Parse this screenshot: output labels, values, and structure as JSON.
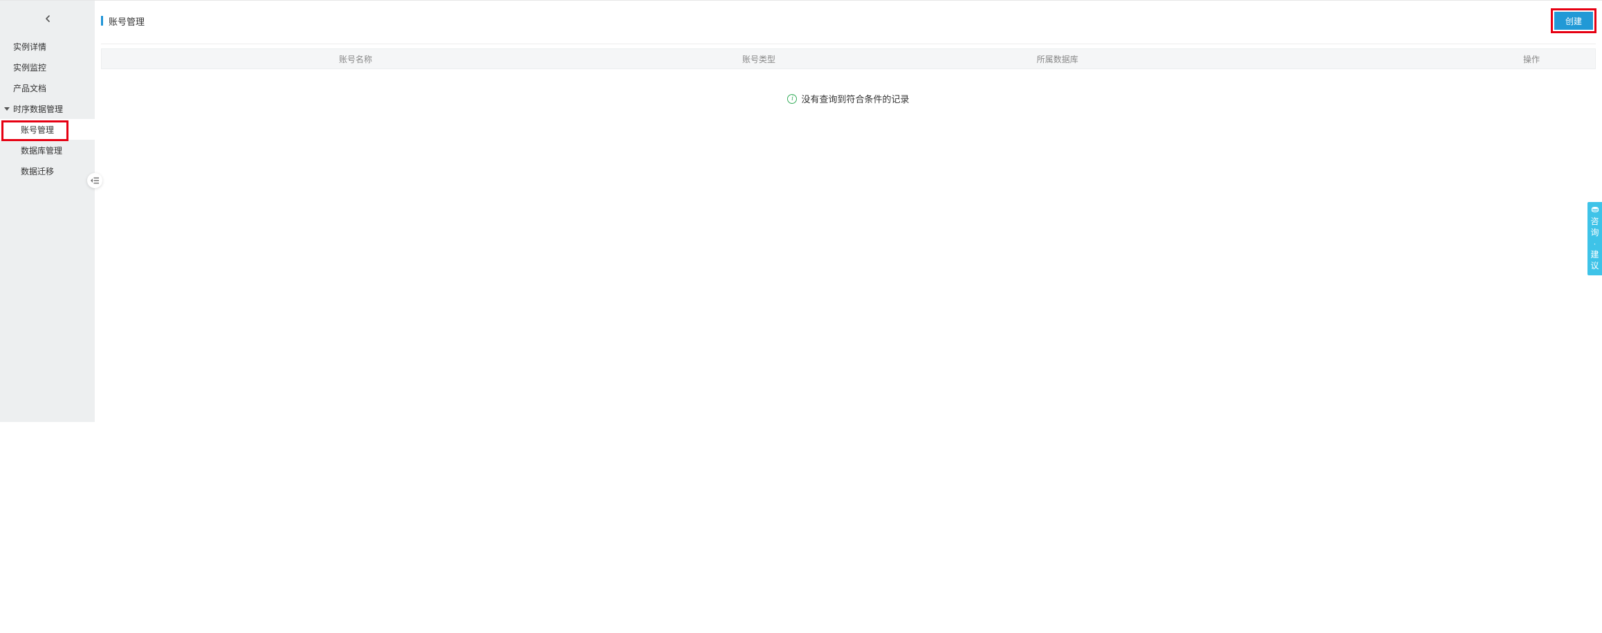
{
  "sidebar": {
    "items": [
      {
        "label": "实例详情"
      },
      {
        "label": "实例监控"
      },
      {
        "label": "产品文档"
      }
    ],
    "group": {
      "label": "时序数据管理"
    },
    "subitems": [
      {
        "label": "账号管理",
        "active": true
      },
      {
        "label": "数据库管理"
      },
      {
        "label": "数据迁移"
      }
    ]
  },
  "header": {
    "title": "账号管理",
    "create_label": "创建"
  },
  "table": {
    "columns": {
      "name": "账号名称",
      "type": "账号类型",
      "database": "所属数据库",
      "operation": "操作"
    },
    "empty_text": "没有查询到符合条件的记录"
  },
  "feedback": {
    "c1": "咨",
    "c2": "询",
    "sep": "·",
    "c3": "建",
    "c4": "议"
  },
  "colors": {
    "accent": "#2199d6",
    "highlight": "#e60012",
    "success": "#35ad5a",
    "feedback_bg": "#3ec3e8"
  }
}
